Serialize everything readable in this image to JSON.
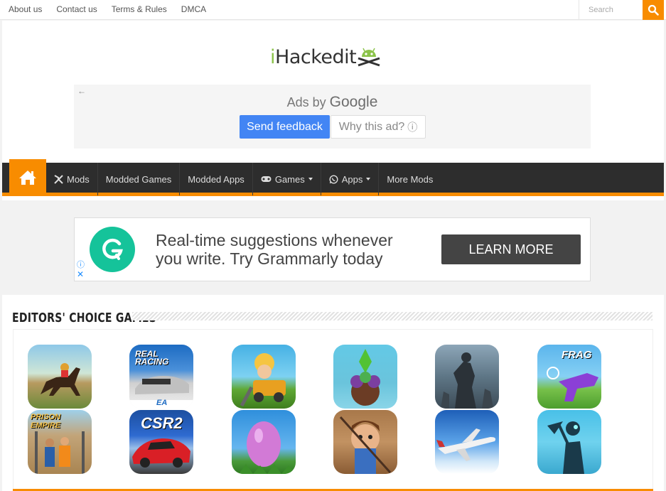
{
  "topbar": {
    "links": [
      "About us",
      "Contact us",
      "Terms & Rules",
      "DMCA"
    ],
    "search_placeholder": "Search"
  },
  "site": {
    "logo_text_i": "i",
    "logo_text_rest": "Hackedit"
  },
  "ad1": {
    "back": "←",
    "ads_by": "Ads by",
    "brand": "Google",
    "feedback": "Send feedback",
    "why": "Why this ad?",
    "why_icon": "ⓘ"
  },
  "nav": {
    "items": [
      {
        "label": "Mods",
        "icon": "mods-icon"
      },
      {
        "label": "Modded Games"
      },
      {
        "label": "Modded Apps"
      },
      {
        "label": "Games",
        "icon": "gamepad-icon",
        "dropdown": true
      },
      {
        "label": "Apps",
        "icon": "whatsapp-icon",
        "dropdown": true
      },
      {
        "label": "More Mods"
      }
    ]
  },
  "ad2": {
    "line1": "Real-time suggestions whenever",
    "line2": "you write. Try Grammarly today",
    "cta": "LEARN MORE",
    "info": "ⓘ",
    "close": "✕"
  },
  "editors": {
    "title": "EDITORS' CHOICE GAMES",
    "games": [
      {
        "name": "horse-racing",
        "label": ""
      },
      {
        "name": "real-racing",
        "label": "REAL RACING"
      },
      {
        "name": "mining-tycoon",
        "label": ""
      },
      {
        "name": "sims",
        "label": ""
      },
      {
        "name": "dead-trigger",
        "label": ""
      },
      {
        "name": "frag",
        "label": "FRAG"
      },
      {
        "name": "prison-empire",
        "label": "PRISON EMPIRE"
      },
      {
        "name": "csr2",
        "label": "CSR2"
      },
      {
        "name": "egg",
        "label": ""
      },
      {
        "name": "jetpack",
        "label": ""
      },
      {
        "name": "flight-pilot",
        "label": ""
      },
      {
        "name": "shadow-miner",
        "label": ""
      }
    ],
    "ea_text": "EA"
  },
  "colors": {
    "accent": "#f88c00",
    "nav_bg": "#2d2d2d",
    "google_blue": "#4285f4",
    "grammarly": "#15c39a"
  }
}
